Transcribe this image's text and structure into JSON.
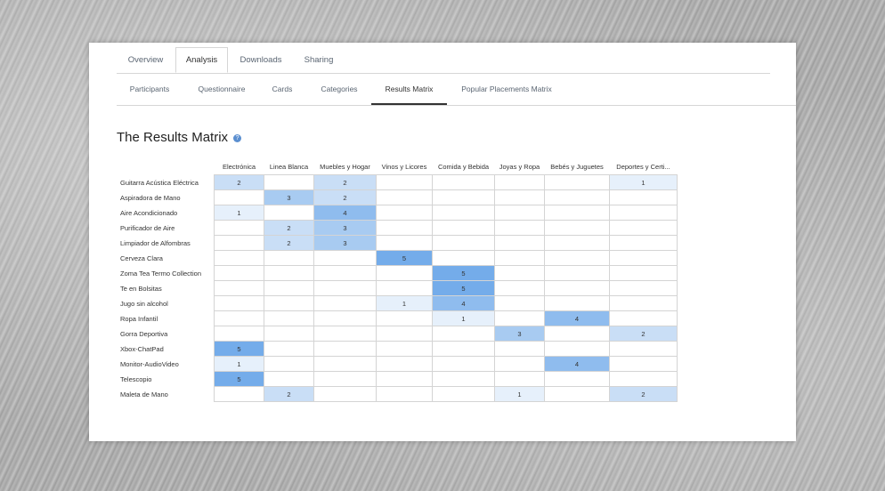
{
  "tabs": [
    "Overview",
    "Analysis",
    "Downloads",
    "Sharing"
  ],
  "active_tab": "Analysis",
  "subtabs": [
    "Participants",
    "Questionnaire",
    "Cards",
    "Categories",
    "Results Matrix",
    "Popular Placements Matrix"
  ],
  "active_subtab": "Results Matrix",
  "page_title": "The Results Matrix",
  "help_icon_glyph": "?",
  "colors": {
    "level1": "#e6f0fb",
    "level2": "#c9def6",
    "level3": "#a8cbf1",
    "level4": "#8fbcee",
    "level5": "#74acea"
  },
  "matrix": {
    "columns": [
      "Electrónica",
      "Linea Blanca",
      "Muebles y Hogar",
      "Vinos y Licores",
      "Comida y Bebida",
      "Joyas y Ropa",
      "Bebés y Juguetes",
      "Deportes y Certi..."
    ],
    "rows": [
      {
        "label": "Guitarra Acústica Eléctrica",
        "values": [
          2,
          null,
          2,
          null,
          null,
          null,
          null,
          1
        ]
      },
      {
        "label": "Aspiradora de Mano",
        "values": [
          null,
          3,
          2,
          null,
          null,
          null,
          null,
          null
        ]
      },
      {
        "label": "Aire Acondicionado",
        "values": [
          1,
          null,
          4,
          null,
          null,
          null,
          null,
          null
        ]
      },
      {
        "label": "Purificador de Aire",
        "values": [
          null,
          2,
          3,
          null,
          null,
          null,
          null,
          null
        ]
      },
      {
        "label": "Limpiador de Alfombras",
        "values": [
          null,
          2,
          3,
          null,
          null,
          null,
          null,
          null
        ]
      },
      {
        "label": "Cerveza Clara",
        "values": [
          null,
          null,
          null,
          5,
          null,
          null,
          null,
          null
        ]
      },
      {
        "label": "Zoma Tea Termo Collection",
        "values": [
          null,
          null,
          null,
          null,
          5,
          null,
          null,
          null
        ]
      },
      {
        "label": "Te en Bolsitas",
        "values": [
          null,
          null,
          null,
          null,
          5,
          null,
          null,
          null
        ]
      },
      {
        "label": "Jugo sin alcohol",
        "values": [
          null,
          null,
          null,
          1,
          4,
          null,
          null,
          null
        ]
      },
      {
        "label": "Ropa Infantil",
        "values": [
          null,
          null,
          null,
          null,
          1,
          null,
          4,
          null
        ]
      },
      {
        "label": "Gorra Deportiva",
        "values": [
          null,
          null,
          null,
          null,
          null,
          3,
          null,
          2
        ]
      },
      {
        "label": "Xbox-ChatPad",
        "values": [
          5,
          null,
          null,
          null,
          null,
          null,
          null,
          null
        ]
      },
      {
        "label": "Monitor-AudioVideo",
        "values": [
          1,
          null,
          null,
          null,
          null,
          null,
          4,
          null
        ]
      },
      {
        "label": "Telescopio",
        "values": [
          5,
          null,
          null,
          null,
          null,
          null,
          null,
          null
        ]
      },
      {
        "label": "Maleta de Mano",
        "values": [
          null,
          2,
          null,
          null,
          null,
          1,
          null,
          2
        ]
      }
    ]
  }
}
